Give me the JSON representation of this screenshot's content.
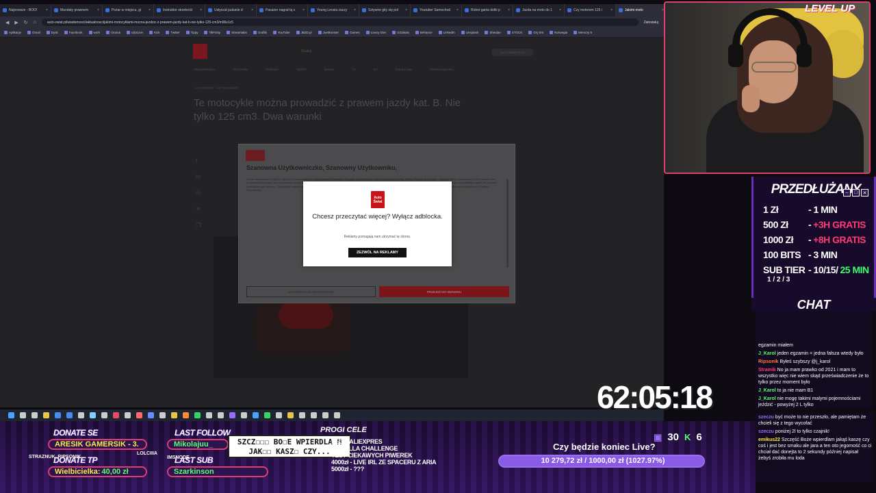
{
  "browser": {
    "tabs": [
      "Najnowsze - BOO!",
      "Mandaty prawnem",
      "Pożar w miejscu, gi",
      "Instruktor strzelecki",
      "Usłyszał pukanie d",
      "Pasażer nagrał tą s",
      "Young Leosia zaczy",
      "Sztywne gity się poł",
      "Youtuber Samochod",
      "Robot gania dolki p",
      "Jazda na moto do 1",
      "Czy motorem 125 i",
      "Jakimi moto"
    ],
    "url": "auto-swiat.pl/wiadomosci/aktualnosci/jakimi-motocyklami-mozna-jezdzic-z-prawem-jazdy-kat-b-nie-tylko-125-cm3/m96x1c5",
    "extension_label": "Zainstaluj",
    "bookmarks": [
      "Aplikacje",
      "Gmail",
      "Dysk",
      "Facebook",
      "work",
      "Oculus",
      "IdiotLive",
      "Kick",
      "Twitter",
      "Tippy",
      "TikFinity",
      "Streamlabs",
      "Grafiki",
      "YouTube",
      "JBZD.pl",
      "JoeMonster",
      "Games",
      "Łowcy Gier",
      "GGdeals",
      "Behance",
      "LinkedIn",
      "Unsplash",
      "Shindan",
      "STOCK",
      "Gry tmt",
      "Norwegia",
      "Memory 5"
    ]
  },
  "site": {
    "search_placeholder": "Szukaj",
    "login_label": "AUTO SWIAT PLUS",
    "nav": [
      "WIADOMOŚCI",
      "TESTOWE",
      "PORADY",
      "TESTY",
      "MARKI",
      "TV",
      "EV",
      "POLECANE",
      "PRZEGLĄDARKI"
    ],
    "breadcrumb": "› AUTOŚWIAT › AKTUALNOŚCI",
    "headline": "Te motocykle można prowadzić z prawem jazdy kat. B. Nie tylko 125 cm3. Dwa warunki"
  },
  "consent": {
    "title": "Szanowna Użytkowniczko, Szanowny Użytkowniku,",
    "body": "Zanim akceptujesz przyjęcie zgody (z przechowaniem i odczytaniem informacji z Twojego urządzenia) w celach opisanych poniżej, kliknij „Przejdź do serwisu”. Zostaną wtedy wykorzystane pliki cookies oraz podobne technologie, aby dopasować treści i reklamy do Twoich zainteresowań, mierzyć ich skuteczność, a także rozwijać i ulepszać nasze usługi. Twoje dane przetwarzamy na podstawie zgody lub prawnie uzasadnionego interesu. Ustawienia możesz zmienić w każdej chwili, korzystając z opcji Ustawienia zaawansowane lub wycofując zgodę w polityce prywatności. Więcej informacji znajdziesz w Polityce Prywatności.",
    "settings_button": "USTAWIENIA ZAAWANSOWANE",
    "accept_button": "PRZEJDŹ DO SERWISU"
  },
  "adblock": {
    "logo_line1": "Auto",
    "logo_line2": "Świat",
    "title": "Chcesz przeczytać więcej? Wyłącz adblocka.",
    "subtitle": "Reklamy pomagają nam utrzymać tę stronę.",
    "button": "ZEZWÓL NA REKLAMY"
  },
  "stream": {
    "brand": "LEVEL UP",
    "timer": "62:05:18",
    "panel_title": "PRZEDŁUŻANY",
    "pricing": [
      {
        "left": "1 Zł",
        "right": "- 1 MIN",
        "bonus": ""
      },
      {
        "left": "500 Zł",
        "right": "-",
        "bonus": "+3H GRATIS"
      },
      {
        "left": "1000 Zł",
        "right": "-",
        "bonus": "+8H GRATIS"
      },
      {
        "left": "100 BITS",
        "right": "- 3 MIN",
        "bonus": ""
      },
      {
        "left": "SUB TIER",
        "right": "- 10/15/",
        "bonus": "25 MIN"
      }
    ],
    "sub_tiers": "1 / 2 / 3",
    "chat_title": "CHAT",
    "chat": [
      {
        "user": "",
        "text": "egzamin miałem",
        "color": "#ffffff"
      },
      {
        "user": "J_Karol",
        "text": "jeden egzamin = jedna fałsza wtedy było",
        "color": "#5bff72"
      },
      {
        "user": "Ripsonik",
        "text": "Byłeś szybszy @j_karol",
        "color": "#ff7a4a"
      },
      {
        "user": "Stramik",
        "text": "No ja mam prawko od 2021 i mam to wszystko więc nie wiem skąd przeświadczenie że to tylko przez moment było",
        "color": "#ff3a77"
      },
      {
        "user": "J_Karol",
        "text": "to ja nie mam B1",
        "color": "#5bff72"
      },
      {
        "user": "J_Karol",
        "text": "nie mogę takimi malymi pojemnościami jeździć - powyżej 2 L tylko",
        "color": "#5bff72"
      }
    ],
    "chat2": [
      {
        "user": "szeczu",
        "text": "być może to nie przeszło, ale pamiętam że chcieli się z tego wycofać",
        "color": "#9c6ff0"
      },
      {
        "user": "szeczu",
        "text": "poniżej 2l to tylko czajnik!",
        "color": "#9c6ff0"
      },
      {
        "user": "emikus22",
        "text": "Szczęść Boże wpierdlam jakąś kaszę czy coś i jest bez smaku ale jara a ten oto jegomość co ci chciał dać donejta to 2 sekundy później napisał żebyś zrobiła mu loda",
        "color": "#ffe94a"
      }
    ],
    "donate_label": "DONATE SE",
    "donate_se": "ARESIK GAMERSIK - 3.",
    "donate_tp_label": "DONATE TP",
    "donate_tp_name": "Wielbicielka:",
    "donate_tp_amount": "40,00 zł",
    "last_follow_label": "LAST FOLLOW",
    "last_follow": "Mikolajuu_",
    "last_sub_label": "LAST SUB",
    "last_sub": "Szarkinson",
    "speech": "SZCZ☐☐☐ BO☐E WPIERDLA M JAK☐☐ KASZ☐ CZY...",
    "progi_title": "PROGI CELE",
    "progi": [
      "LEGO ALIEXPRES",
      "TORTILLA CHALLENGE",
      "TEST CIEKAWYCH PIWEREK",
      "4000zł - LIVE IRL ZE SPACERU Z ARIA",
      "5000zł - ???"
    ],
    "question": "Czy będzie koniec Live?",
    "goal_text": "10 279,72 zł / 1000,00 zł (1027.97%)",
    "goal_fraction": 1.0,
    "viewers": "30",
    "kick_count": "6",
    "names_small": [
      "STRAZNUK_RIPSONIK",
      "LOLCIIIA",
      "IMSNODE"
    ]
  },
  "colors": {
    "accent": "#e23d6f",
    "purple": "#6a2fb3",
    "green": "#5bff72",
    "yellow": "#ffe94a"
  }
}
